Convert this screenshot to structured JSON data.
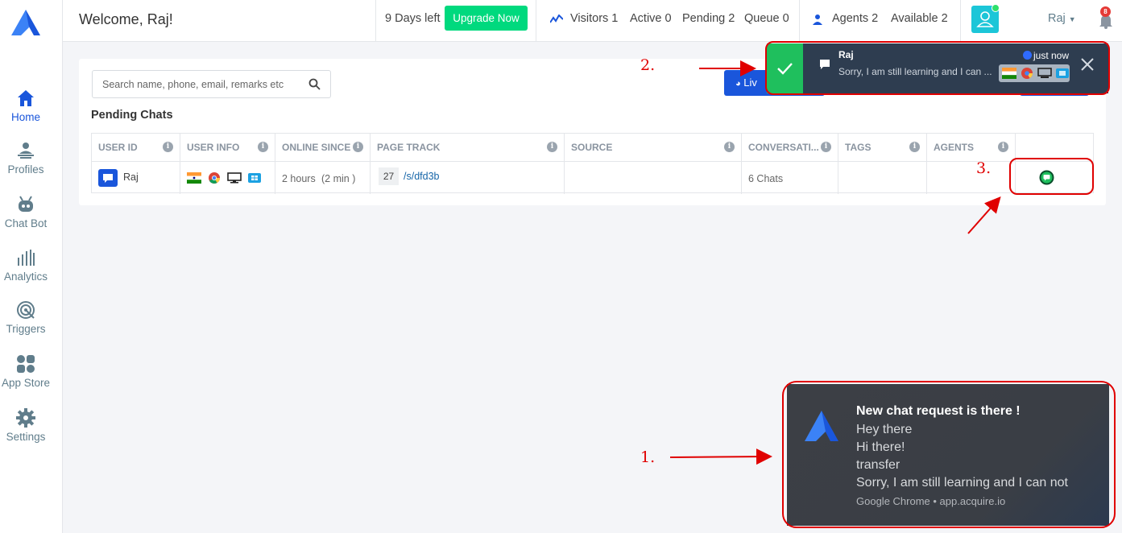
{
  "sidebar": {
    "items": [
      {
        "label": "Home",
        "icon": "home-icon"
      },
      {
        "label": "Profiles",
        "icon": "profiles-icon"
      },
      {
        "label": "Chat Bot",
        "icon": "chatbot-icon"
      },
      {
        "label": "Analytics",
        "icon": "analytics-icon"
      },
      {
        "label": "Triggers",
        "icon": "triggers-icon"
      },
      {
        "label": "App Store",
        "icon": "appstore-icon"
      },
      {
        "label": "Settings",
        "icon": "gear-icon"
      }
    ]
  },
  "header": {
    "welcome": "Welcome, Raj!",
    "trial": "9 Days left",
    "upgrade_label": "Upgrade Now",
    "visitors": "Visitors 1",
    "active": "Active 0",
    "pending": "Pending 2",
    "queue": "Queue 0",
    "agents": "Agents 2",
    "available": "Available 2",
    "user": "Raj",
    "notification_count": "8"
  },
  "main": {
    "search_placeholder": "Search name, phone, email, remarks etc",
    "live_button": "Liv",
    "section_title": "Pending Chats",
    "columns": [
      "USER ID",
      "USER INFO",
      "ONLINE SINCE",
      "PAGE TRACK",
      "SOURCE",
      "CONVERSATI...",
      "TAGS",
      "AGENTS"
    ],
    "row": {
      "user_id": "Raj",
      "online_since": "2 hours",
      "online_since_sub": "(2 min )",
      "page_count": "27",
      "page_path": "/s/dfd3b",
      "conversations": "6 Chats"
    }
  },
  "toast": {
    "name": "Raj",
    "message": "Sorry, I am still learning and I can ...",
    "time": "just now"
  },
  "notification": {
    "title": "New chat request is there !",
    "lines": [
      "Hey there",
      "Hi there!",
      "transfer",
      "Sorry, I am still learning and I can not"
    ],
    "source": "Google Chrome • app.acquire.io"
  },
  "annotations": {
    "one": "1.",
    "two": "2.",
    "three": "3."
  },
  "colors": {
    "accent": "#1a56db",
    "upgrade": "#00d97e",
    "annotation": "#e00000",
    "toast_bg": "#2e3d50",
    "success": "#1fbf5d"
  }
}
